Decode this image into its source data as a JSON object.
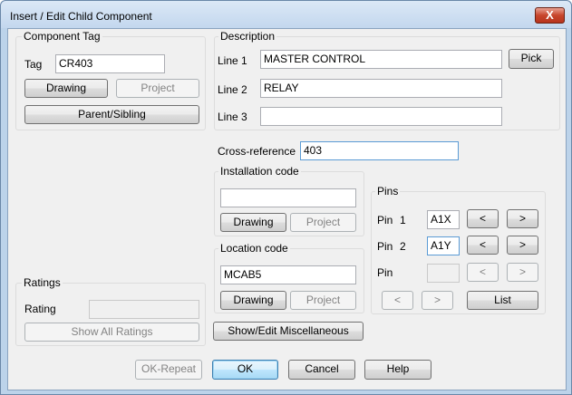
{
  "window": {
    "title": "Insert / Edit Child Component",
    "close_glyph": "X"
  },
  "component_tag": {
    "title": "Component Tag",
    "tag_label": "Tag",
    "tag_value": "CR403",
    "drawing_button": "Drawing",
    "project_button": "Project",
    "parent_sibling_button": "Parent/Sibling"
  },
  "description": {
    "title": "Description",
    "line1_label": "Line 1",
    "line1_value": "MASTER CONTROL",
    "line2_label": "Line 2",
    "line2_value": "RELAY",
    "line3_label": "Line 3",
    "line3_value": "",
    "pick_button": "Pick"
  },
  "cross_reference": {
    "label": "Cross-reference",
    "value": "403"
  },
  "installation_code": {
    "title": "Installation code",
    "value": "",
    "drawing_button": "Drawing",
    "project_button": "Project"
  },
  "location_code": {
    "title": "Location code",
    "value": "MCAB5",
    "drawing_button": "Drawing",
    "project_button": "Project"
  },
  "pins": {
    "title": "Pins",
    "rows": [
      {
        "label": "Pin",
        "num": "1",
        "value": "A1X",
        "prev": "<",
        "next": ">"
      },
      {
        "label": "Pin",
        "num": "2",
        "value": "A1Y",
        "prev": "<",
        "next": ">"
      },
      {
        "label": "Pin",
        "num": "",
        "value": "",
        "prev": "<",
        "next": ">"
      }
    ],
    "page_prev": "<",
    "page_next": ">",
    "list_button": "List"
  },
  "ratings": {
    "title": "Ratings",
    "rating_label": "Rating",
    "rating_value": "",
    "show_all_button": "Show All Ratings"
  },
  "misc_button": "Show/Edit Miscellaneous",
  "footer": {
    "ok_repeat": "OK-Repeat",
    "ok": "OK",
    "cancel": "Cancel",
    "help": "Help"
  }
}
